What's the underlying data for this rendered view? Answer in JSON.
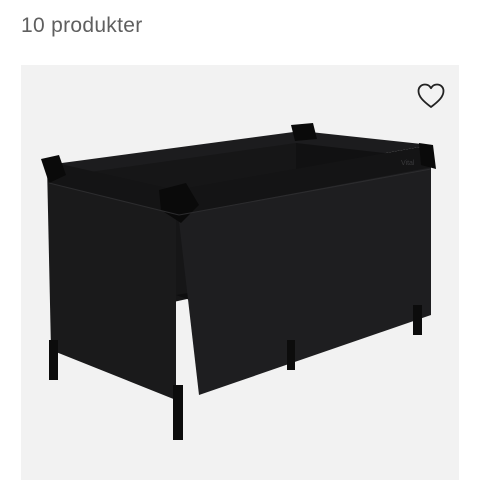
{
  "results": {
    "count_label": "10 produkter"
  },
  "product": {
    "brand_mark": "Vital",
    "image_icon": "travel-cot-image",
    "wishlist_icon": "heart-outline-icon",
    "colors": {
      "card_background": "#f2f2f2",
      "cot_fabric": "#1c1c1e",
      "mesh": "#dcdcdc",
      "heart_stroke": "#222222"
    }
  }
}
